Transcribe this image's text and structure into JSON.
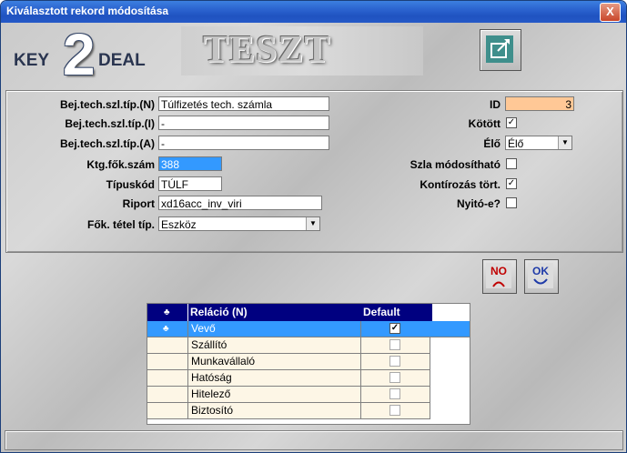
{
  "window": {
    "title": "Kiválasztott rekord módosítása",
    "close_label": "X"
  },
  "logo": {
    "key": "KEY",
    "two": "2",
    "deal": "DEAL"
  },
  "banner": {
    "text": "TESZT"
  },
  "form_left": {
    "field1": {
      "label": "Bej.tech.szl.típ.(N)",
      "value": "Túlfizetés tech. számla"
    },
    "field2": {
      "label": "Bej.tech.szl.típ.(I)",
      "value": "-"
    },
    "field3": {
      "label": "Bej.tech.szl.típ.(A)",
      "value": "-"
    },
    "field4": {
      "label": "Ktg.fők.szám",
      "value": "388"
    },
    "field5": {
      "label": "Típuskód",
      "value": "TÚLF"
    },
    "field6": {
      "label": "Riport",
      "value": "xd16acc_inv_viri"
    },
    "field7": {
      "label": "Fők. tétel típ.",
      "value": "Eszköz"
    }
  },
  "form_right": {
    "id": {
      "label": "ID",
      "value": "3"
    },
    "kotott": {
      "label": "Kötött",
      "checked": "✓"
    },
    "elo": {
      "label": "Élő",
      "value": "Élő"
    },
    "szla": {
      "label": "Szla módosítható",
      "checked": ""
    },
    "kontir": {
      "label": "Kontírozás tört.",
      "checked": "✓"
    },
    "nyito": {
      "label": "Nyitó-e?",
      "checked": ""
    }
  },
  "buttons": {
    "no": "NO",
    "ok": "OK"
  },
  "grid": {
    "columns": [
      "Reláció (N)",
      "Default"
    ],
    "rows": [
      {
        "name": "Vevő",
        "default": "✓"
      },
      {
        "name": "Szállító",
        "default": ""
      },
      {
        "name": "Munkavállaló",
        "default": ""
      },
      {
        "name": "Hatóság",
        "default": ""
      },
      {
        "name": "Hitelező",
        "default": ""
      },
      {
        "name": "Biztosító",
        "default": ""
      }
    ]
  },
  "colors": {
    "titlebar": "#2b63cf",
    "id_field": "#ffc896",
    "selected_row": "#3399ff",
    "header": "#000080"
  }
}
